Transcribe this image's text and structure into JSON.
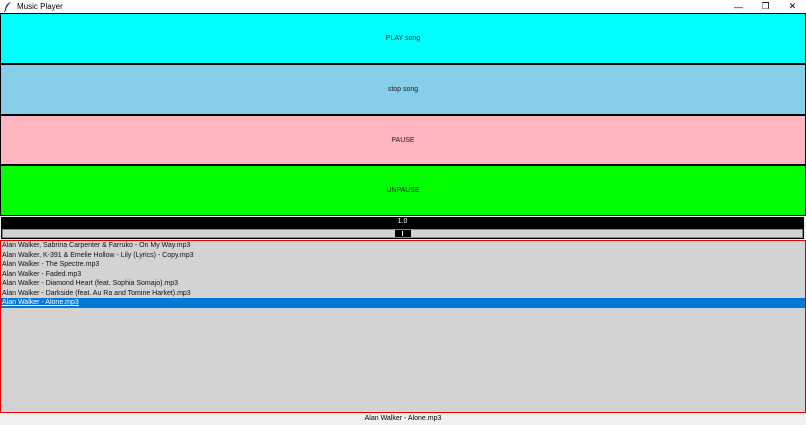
{
  "window": {
    "title": "Music Player",
    "icon": "feather-icon",
    "controls": {
      "minimize": "—",
      "restore": "❐",
      "close": "✕"
    }
  },
  "buttons": [
    {
      "label": "PLAY song",
      "color": "#00ffff"
    },
    {
      "label": "stop song",
      "color": "#87ceeb"
    },
    {
      "label": "PAUSE",
      "color": "#ffb6c1"
    },
    {
      "label": "UNPAUSE",
      "color": "#00ff00"
    }
  ],
  "volume": {
    "value": "1.0",
    "level": 1.0
  },
  "playlist": {
    "items": [
      "Alan Walker, Sabrina Carpenter & Farruko  - On My Way.mp3",
      "Alan Walker, K-391 & Emelie Hollow - Lily (Lyrics) - Copy.mp3",
      "Alan Walker - The Spectre.mp3",
      "Alan Walker - Faded.mp3",
      "Alan Walker - Diamond Heart (feat. Sophia Somajo).mp3",
      "Alan Walker - Darkside (feat. Au Ra and Tomine Harket).mp3",
      "Alan Walker - Alone.mp3"
    ],
    "selected_index": 6
  },
  "status": {
    "current_song": "Alan Walker - Alone.mp3"
  },
  "colors": {
    "selection": "#0078d7",
    "listbox_bg": "#d3d3d3",
    "listbox_border": "#e00000"
  }
}
